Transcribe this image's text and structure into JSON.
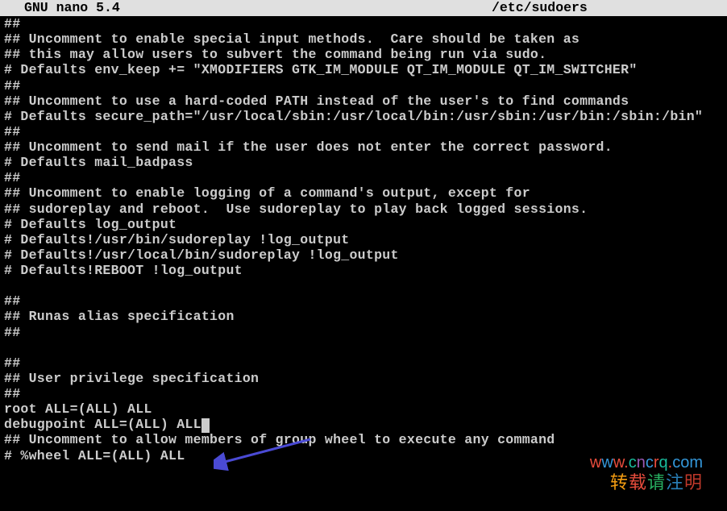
{
  "titlebar": {
    "app": "GNU nano 5.4",
    "file": "/etc/sudoers"
  },
  "lines": [
    "##",
    "## Uncomment to enable special input methods.  Care should be taken as",
    "## this may allow users to subvert the command being run via sudo.",
    "# Defaults env_keep += \"XMODIFIERS GTK_IM_MODULE QT_IM_MODULE QT_IM_SWITCHER\"",
    "##",
    "## Uncomment to use a hard-coded PATH instead of the user's to find commands",
    "# Defaults secure_path=\"/usr/local/sbin:/usr/local/bin:/usr/sbin:/usr/bin:/sbin:/bin\"",
    "##",
    "## Uncomment to send mail if the user does not enter the correct password.",
    "# Defaults mail_badpass",
    "##",
    "## Uncomment to enable logging of a command's output, except for",
    "## sudoreplay and reboot.  Use sudoreplay to play back logged sessions.",
    "# Defaults log_output",
    "# Defaults!/usr/bin/sudoreplay !log_output",
    "# Defaults!/usr/local/bin/sudoreplay !log_output",
    "# Defaults!REBOOT !log_output",
    "",
    "##",
    "## Runas alias specification",
    "##",
    "",
    "##",
    "## User privilege specification",
    "##",
    "root ALL=(ALL) ALL",
    "debugpoint ALL=(ALL) ALL",
    "## Uncomment to allow members of group wheel to execute any command",
    "# %wheel ALL=(ALL) ALL"
  ],
  "cursor_line_index": 26,
  "watermark": {
    "url": "www.cncrq.com",
    "cn": "转载请注明"
  }
}
